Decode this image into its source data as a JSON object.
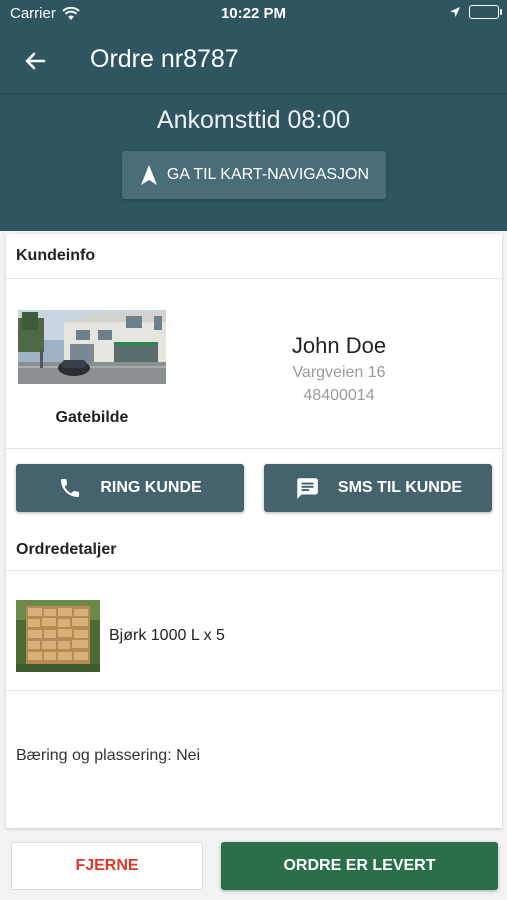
{
  "status_bar": {
    "carrier": "Carrier",
    "time": "10:22 PM"
  },
  "header": {
    "title": "Ordre nr8787"
  },
  "arrival": {
    "label": "Ankomsttid 08:00",
    "nav_button": "GA TIL KART-NAVIGASJON"
  },
  "customer": {
    "section_title": "Kundeinfo",
    "street_image_label": "Gatebilde",
    "name": "John Doe",
    "address": "Vargveien 16",
    "phone": "48400014"
  },
  "actions": {
    "call": "RING KUNDE",
    "sms": "SMS TIL KUNDE"
  },
  "order": {
    "section_title": "Ordredetaljer",
    "item": "Bjørk 1000 L x 5",
    "carry": "Bæring og plassering: Nei"
  },
  "footer": {
    "remove": "FJERNE",
    "delivered": "ORDRE ER LEVERT"
  },
  "colors": {
    "primary": "#2e5560",
    "button": "#44636d",
    "success": "#2a6f49",
    "danger": "#e0362c"
  },
  "icons": [
    "wifi-icon",
    "location-arrow-icon",
    "battery-icon",
    "back-arrow-icon",
    "navigation-icon",
    "phone-icon",
    "message-icon"
  ]
}
